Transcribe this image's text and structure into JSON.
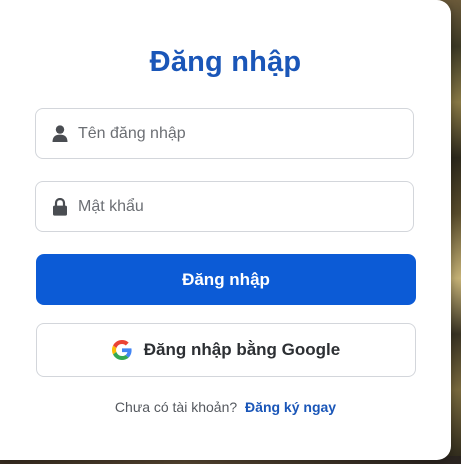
{
  "login": {
    "title": "Đăng nhập",
    "username": {
      "placeholder": "Tên đăng nhập",
      "value": "",
      "icon": "user-icon"
    },
    "password": {
      "placeholder": "Mật khẩu",
      "value": "",
      "icon": "lock-icon"
    },
    "submit_label": "Đăng nhập",
    "google_label": "Đăng nhập bằng Google",
    "google_icon": "google-g-icon",
    "signup_prompt": "Chưa có tài khoản?",
    "signup_link": "Đăng ký ngay"
  },
  "colors": {
    "primary": "#0c5bd6",
    "title": "#1a56b8",
    "border": "#d3d6db"
  }
}
